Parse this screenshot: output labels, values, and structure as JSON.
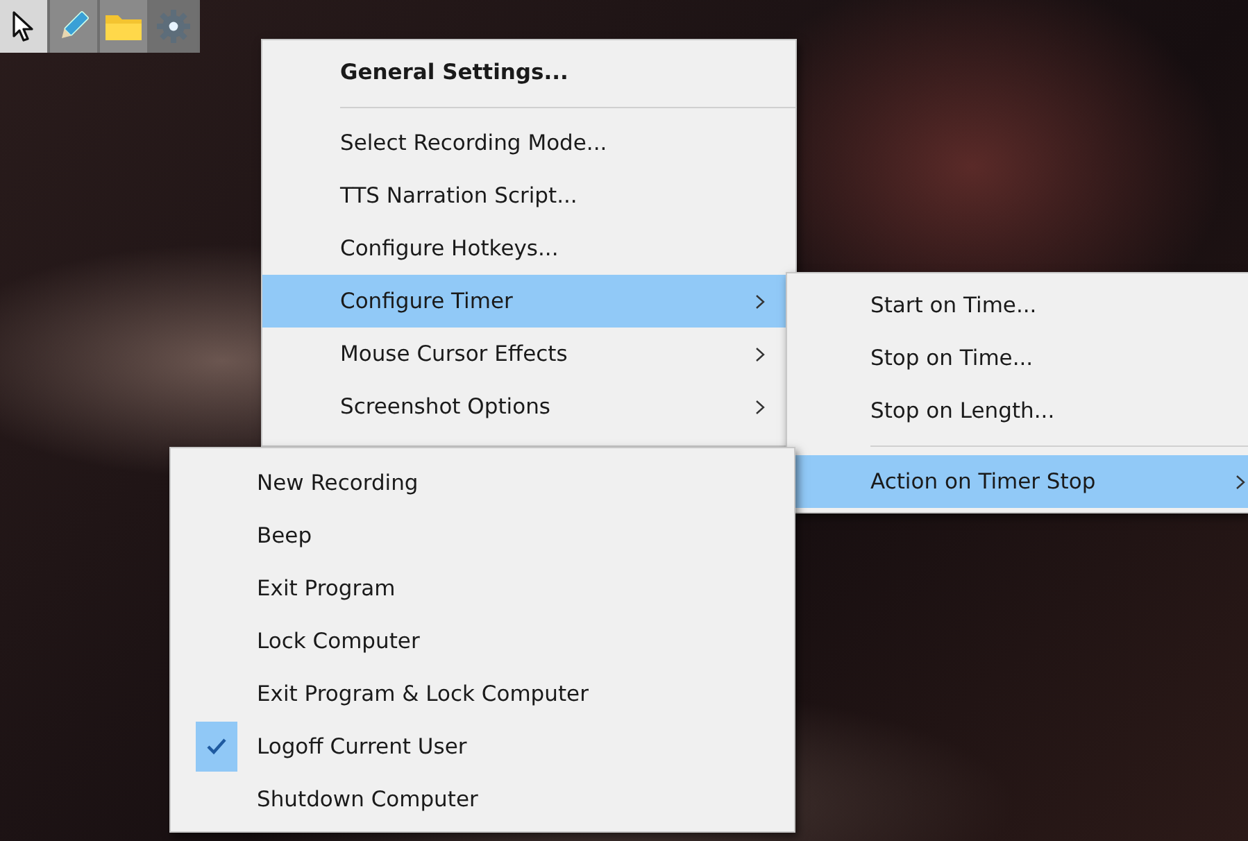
{
  "toolbar": {
    "buttons": [
      {
        "kind": "pointer",
        "selected": false
      },
      {
        "kind": "pencil",
        "selected": false
      },
      {
        "kind": "folder",
        "selected": false
      },
      {
        "kind": "gear",
        "selected": true
      }
    ]
  },
  "settings_menu": {
    "items": [
      {
        "kind": "heading",
        "label": "General Settings...",
        "selected": false,
        "submenu": false
      },
      {
        "kind": "separator"
      },
      {
        "kind": "item",
        "label": "Select Recording Mode...",
        "selected": false,
        "submenu": false
      },
      {
        "kind": "item",
        "label": "TTS Narration Script...",
        "selected": false,
        "submenu": false
      },
      {
        "kind": "item",
        "label": "Configure Hotkeys...",
        "selected": false,
        "submenu": false
      },
      {
        "kind": "item",
        "label": "Configure Timer",
        "selected": true,
        "submenu": true
      },
      {
        "kind": "item",
        "label": "Mouse Cursor Effects",
        "selected": false,
        "submenu": true
      },
      {
        "kind": "item",
        "label": "Screenshot Options",
        "selected": false,
        "submenu": true
      }
    ]
  },
  "timer_menu": {
    "items": [
      {
        "kind": "item",
        "label": "Start on Time...",
        "selected": false,
        "submenu": false
      },
      {
        "kind": "item",
        "label": "Stop on Time...",
        "selected": false,
        "submenu": false
      },
      {
        "kind": "item",
        "label": "Stop on Length...",
        "selected": false,
        "submenu": false
      },
      {
        "kind": "separator"
      },
      {
        "kind": "item",
        "label": "Action on Timer Stop",
        "selected": true,
        "submenu": true
      }
    ]
  },
  "action_menu": {
    "items": [
      {
        "label": "New Recording",
        "checked": false
      },
      {
        "label": "Beep",
        "checked": false
      },
      {
        "label": "Exit Program",
        "checked": false
      },
      {
        "label": "Lock Computer",
        "checked": false
      },
      {
        "label": "Exit Program & Lock Computer",
        "checked": false
      },
      {
        "label": "Logoff Current User",
        "checked": true
      },
      {
        "label": "Shutdown Computer",
        "checked": false
      }
    ]
  }
}
